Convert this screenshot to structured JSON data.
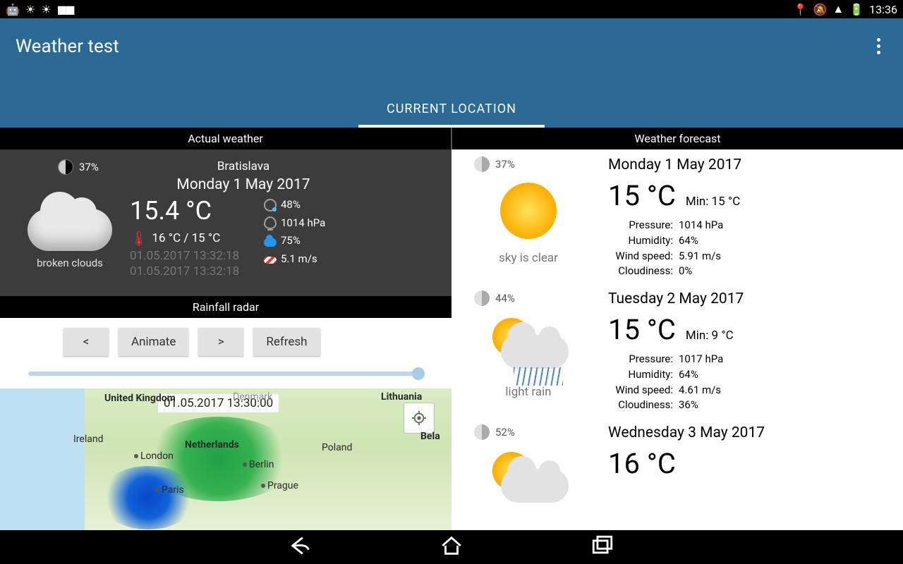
{
  "status": {
    "time": "13:36"
  },
  "appbar": {
    "title": "Weather test",
    "tab": "CURRENT LOCATION"
  },
  "headers": {
    "left": "Actual weather",
    "right": "Weather forecast"
  },
  "actual": {
    "moon": "37%",
    "city": "Bratislava",
    "date": "Monday 1 May 2017",
    "temp": "15.4 °C",
    "hl": "16 °C / 15 °C",
    "ts1": "01.05.2017 13:32:18",
    "ts2": "01.05.2017 13:32:18",
    "cond": "broken clouds",
    "humidity": "48%",
    "pressure": "1014 hPa",
    "cloud": "75%",
    "wind": "5.1 m/s"
  },
  "radar": {
    "title": "Rainfall radar",
    "prev": "<",
    "animate": "Animate",
    "next": ">",
    "refresh": "Refresh",
    "map_ts": "01.05.2017 13:30:00",
    "labels": {
      "uk": "United Kingdom",
      "ireland": "Ireland",
      "denmark": "Denmark",
      "lithuania": "Lithuania",
      "bela": "Bela",
      "netherlands": "Netherlands",
      "poland": "Poland",
      "london": "London",
      "berlin": "Berlin",
      "paris": "Paris",
      "prague": "Prague"
    }
  },
  "forecast": [
    {
      "moon": "37%",
      "cond": "sky is clear",
      "date": "Monday 1 May 2017",
      "temp": "15 °C",
      "min": "Min: 15 °C",
      "pressure": "1014 hPa",
      "humidity": "64%",
      "wind": "5.91 m/s",
      "cloud": "0%"
    },
    {
      "moon": "44%",
      "cond": "light rain",
      "date": "Tuesday 2 May 2017",
      "temp": "15 °C",
      "min": "Min: 9 °C",
      "pressure": "1017 hPa",
      "humidity": "64%",
      "wind": "4.61 m/s",
      "cloud": "36%"
    },
    {
      "moon": "52%",
      "cond": "",
      "date": "Wednesday 3 May 2017",
      "temp": "16 °C",
      "min": "",
      "pressure": "",
      "humidity": "",
      "wind": "",
      "cloud": ""
    }
  ],
  "stat_labels": {
    "pressure": "Pressure:",
    "humidity": "Humidity:",
    "wind": "Wind speed:",
    "cloud": "Cloudiness:"
  }
}
